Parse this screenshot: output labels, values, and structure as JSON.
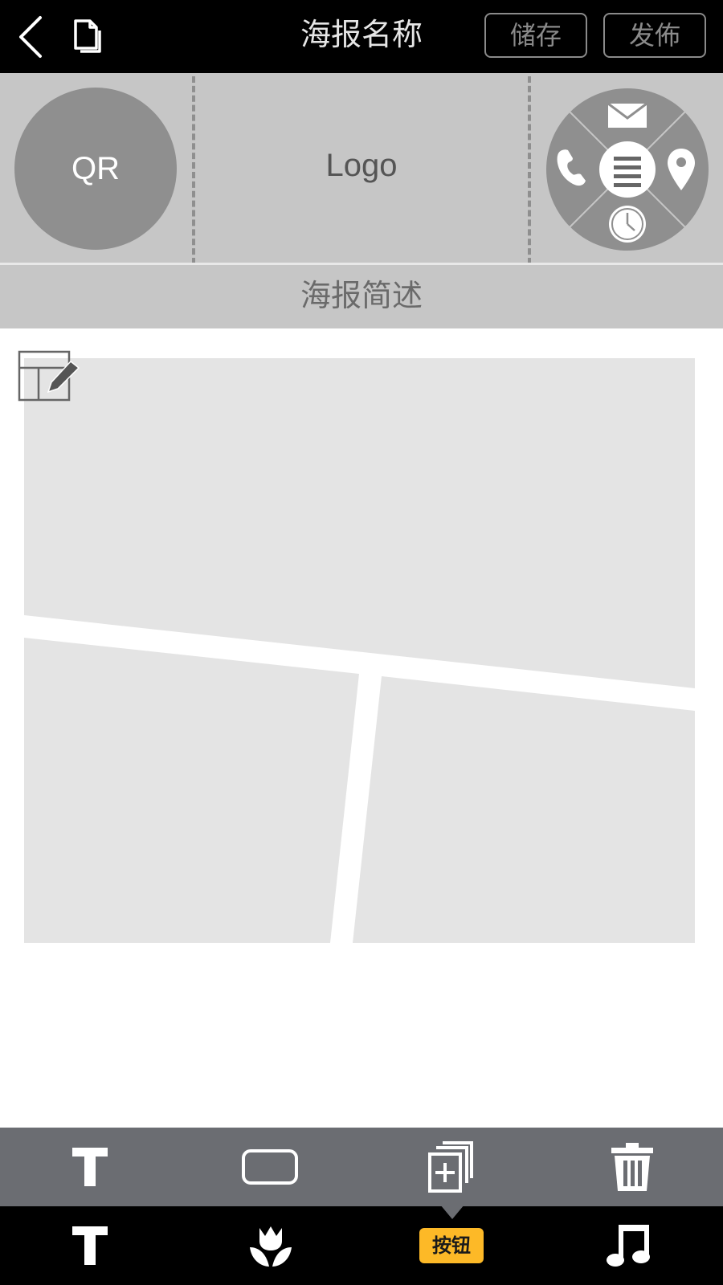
{
  "topbar": {
    "title": "海报名称",
    "save_label": "储存",
    "publish_label": "发佈",
    "icons": [
      "back-icon",
      "document-icon"
    ]
  },
  "header": {
    "qr_label": "QR",
    "logo_label": "Logo",
    "contact_icons": [
      "mail-icon",
      "phone-icon",
      "menu-icon",
      "location-icon",
      "clock-icon"
    ]
  },
  "description": {
    "label": "海报简述"
  },
  "canvas": {
    "layout_icon": "layout-edit-icon",
    "panel_count": 3
  },
  "edit_toolbar": {
    "items": [
      "text-style-icon",
      "button-shape-icon",
      "duplicate-icon",
      "trash-icon"
    ]
  },
  "bottom_bar": {
    "items": [
      "text-icon",
      "flower-icon",
      "button-item",
      "music-icon"
    ],
    "active_label": "按钮"
  },
  "colors": {
    "topbar_bg": "#000000",
    "band_bg": "#c6c6c6",
    "circle_fill": "#8f8f8f",
    "panel_fill": "#e4e4e4",
    "toolbar_bg": "#6b6d72",
    "accent": "#fdb927"
  }
}
